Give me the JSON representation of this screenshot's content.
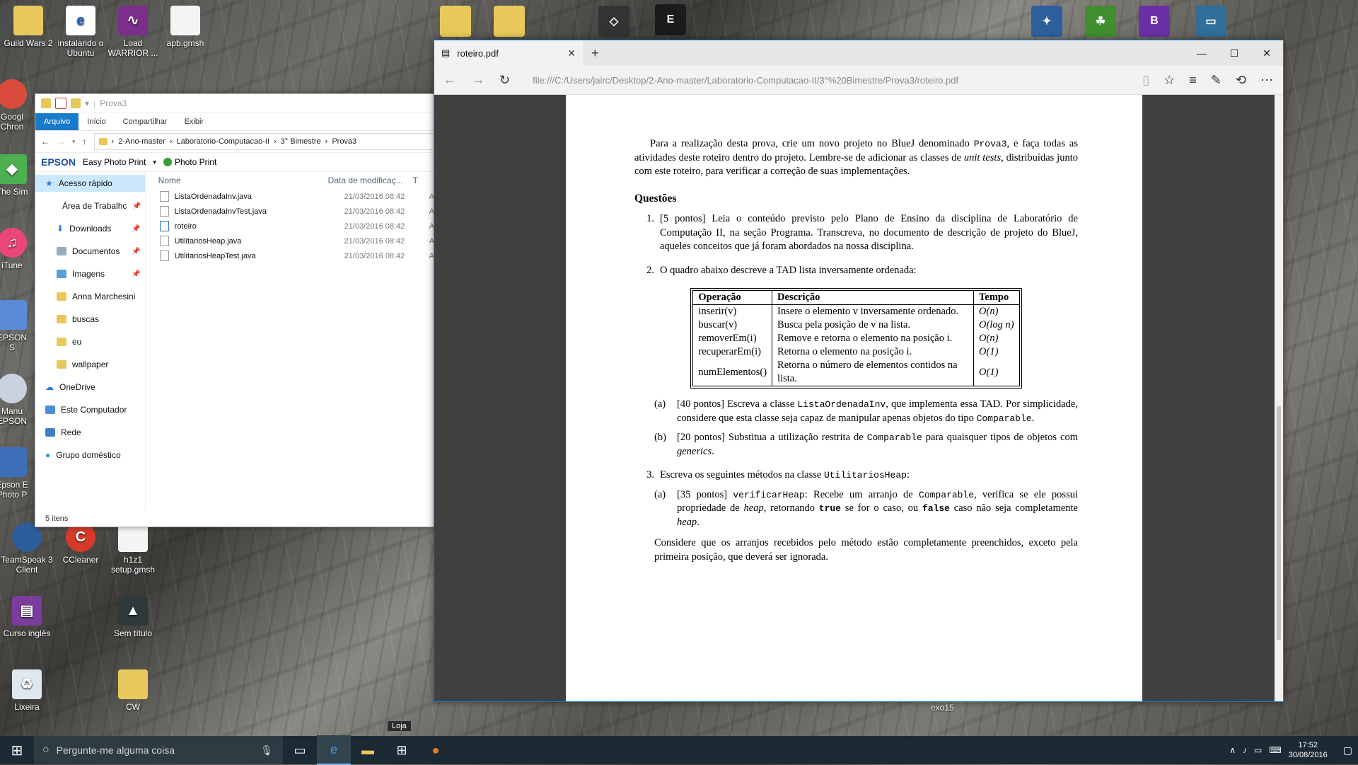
{
  "desktop": {
    "icons_left": [
      {
        "label": "Guild Wars 2",
        "icon": "folder-icon"
      },
      {
        "label": "instalando o Ubuntu",
        "icon": "pdf-icon"
      },
      {
        "label": "Load WARRIOR ...",
        "icon": "shortcut-icon"
      },
      {
        "label": "apb.gmsh",
        "icon": "file-icon"
      }
    ],
    "partial_left": [
      "Googl Chron",
      "The Sim",
      "iTune",
      "EPSON S",
      "Manu EPSON",
      "Epson E Photo P"
    ],
    "icons_bottom": [
      {
        "label": "TeamSpeak 3 Client",
        "icon": "teamspeak-icon"
      },
      {
        "label": "CCleaner",
        "icon": "ccleaner-icon"
      },
      {
        "label": "h1z1 setup.gmsh",
        "icon": "file-icon"
      },
      {
        "label": "Curso inglês",
        "icon": "winrar-icon"
      },
      {
        "label": "Sem título",
        "icon": "image-icon"
      },
      {
        "label": "Lixeira",
        "icon": "recycle-bin-icon"
      },
      {
        "label": "CW",
        "icon": "folder-icon"
      }
    ],
    "exo_label": "exo15"
  },
  "explorer": {
    "title": "Prova3",
    "ribbon_tabs": [
      "Arquivo",
      "Início",
      "Compartilhar",
      "Exibir"
    ],
    "breadcrumb": [
      "2-Ano-master",
      "Laboratorio-Computacao-II",
      "3° Bimestre",
      "Prova3"
    ],
    "epson_brand": "EPSON",
    "epson_app": "Easy Photo Print",
    "photo_print": "Photo Print",
    "nav": [
      {
        "label": "Acesso rápido",
        "pin": false,
        "sub": false
      },
      {
        "label": "Área de Trabalhc",
        "pin": true,
        "sub": true
      },
      {
        "label": "Downloads",
        "pin": true,
        "sub": true
      },
      {
        "label": "Documentos",
        "pin": true,
        "sub": true
      },
      {
        "label": "Imagens",
        "pin": true,
        "sub": true
      },
      {
        "label": "Anna Marchesini",
        "pin": false,
        "sub": true
      },
      {
        "label": "buscas",
        "pin": false,
        "sub": true
      },
      {
        "label": "eu",
        "pin": false,
        "sub": true
      },
      {
        "label": "wallpaper",
        "pin": false,
        "sub": true
      },
      {
        "label": "OneDrive",
        "pin": false,
        "sub": false
      },
      {
        "label": "Este Computador",
        "pin": false,
        "sub": false
      },
      {
        "label": "Rede",
        "pin": false,
        "sub": false
      },
      {
        "label": "Grupo doméstico",
        "pin": false,
        "sub": false
      }
    ],
    "columns": {
      "name": "Nome",
      "date": "Data de modificaç...",
      "type": "T"
    },
    "files": [
      {
        "name": "ListaOrdenadaInv.java",
        "date": "21/03/2016 08:42",
        "type": "A"
      },
      {
        "name": "ListaOrdenadaInvTest.java",
        "date": "21/03/2016 08:42",
        "type": "A"
      },
      {
        "name": "roteiro",
        "date": "21/03/2016 08:42",
        "type": "A"
      },
      {
        "name": "UtilitariosHeap.java",
        "date": "21/03/2016 08:42",
        "type": "A"
      },
      {
        "name": "UtilitariosHeapTest.java",
        "date": "21/03/2016 08:42",
        "type": "A"
      }
    ],
    "status": "5 itens"
  },
  "edge": {
    "tab_title": "roteiro.pdf",
    "url": "file:///C:/Users/jairc/Desktop/2-Ano-master/Laboratorio-Computacao-II/3°%20Bimestre/Prova3/roteiro.pdf"
  },
  "doc": {
    "intro": {
      "a": "Para a realização desta prova, crie um novo projeto no BlueJ denominado ",
      "code": "Prova3",
      "b": ", e faça todas as atividades deste roteiro dentro do projeto. Lembre-se de adicionar as classes de ",
      "em": "unit tests",
      "c": ", distribuídas junto com este roteiro, para verificar a correção de suas implementações."
    },
    "heading": "Questões",
    "q1": {
      "num": "1.",
      "text": "[5 pontos] Leia o conteúdo previsto pelo Plano de Ensino da disciplina de Laboratório de Computação II, na seção Programa. Transcreva, no documento de descrição de projeto do BlueJ, aqueles conceitos que já foram abordados na nossa disciplina."
    },
    "q2": {
      "num": "2.",
      "text": "O quadro abaixo descreve a TAD lista inversamente ordenada:"
    },
    "table": {
      "headers": [
        "Operação",
        "Descrição",
        "Tempo"
      ],
      "rows": [
        [
          "inserir(v)",
          "Insere o elemento v inversamente ordenado.",
          "O(n)"
        ],
        [
          "buscar(v)",
          "Busca pela posição de v na lista.",
          "O(log n)"
        ],
        [
          "removerEm(i)",
          "Remove e retorna o elemento na posição i.",
          "O(n)"
        ],
        [
          "recuperarEm(i)",
          "Retorna o elemento na posição i.",
          "O(1)"
        ],
        [
          "numElementos()",
          "Retorna o número de elementos contidos na lista.",
          "O(1)"
        ]
      ]
    },
    "q2a": {
      "lt": "(a)",
      "a": "[40 pontos] Escreva a classe ",
      "code1": "ListaOrdenadaInv",
      "b": ", que implementa essa TAD. Por simplicidade, considere que esta classe seja capaz de manipular apenas objetos do tipo ",
      "code2": "Comparable",
      "c": "."
    },
    "q2b": {
      "lt": "(b)",
      "a": "[20 pontos] Substitua a utilização restrita de ",
      "code1": "Comparable",
      "b": " para quaisquer tipos de objetos com ",
      "em": "generics",
      "c": "."
    },
    "q3": {
      "num": "3.",
      "a": "Escreva os seguintes métodos na classe ",
      "code": "UtilitariosHeap",
      "b": ":"
    },
    "q3a": {
      "lt": "(a)",
      "a": "[35 pontos] ",
      "code1": "verificarHeap",
      "b": ": Recebe um arranjo de ",
      "code2": "Comparable",
      "c": ", verifica se ele possui propriedade de ",
      "em1": "heap",
      "d": ", retornando ",
      "code3": "true",
      "e": " se for o caso, ou ",
      "code4": "false",
      "f": " caso não seja completamente ",
      "em2": "heap",
      "g": "."
    },
    "closing": "Considere que os arranjos recebidos pelo método estão completamente preenchidos, exceto pela primeira posição, que deverá ser ignorada."
  },
  "taskbar": {
    "search_placeholder": "Pergunte-me alguma coisa",
    "tooltip": "Loja",
    "time": "17:52",
    "date": "30/08/2016"
  }
}
